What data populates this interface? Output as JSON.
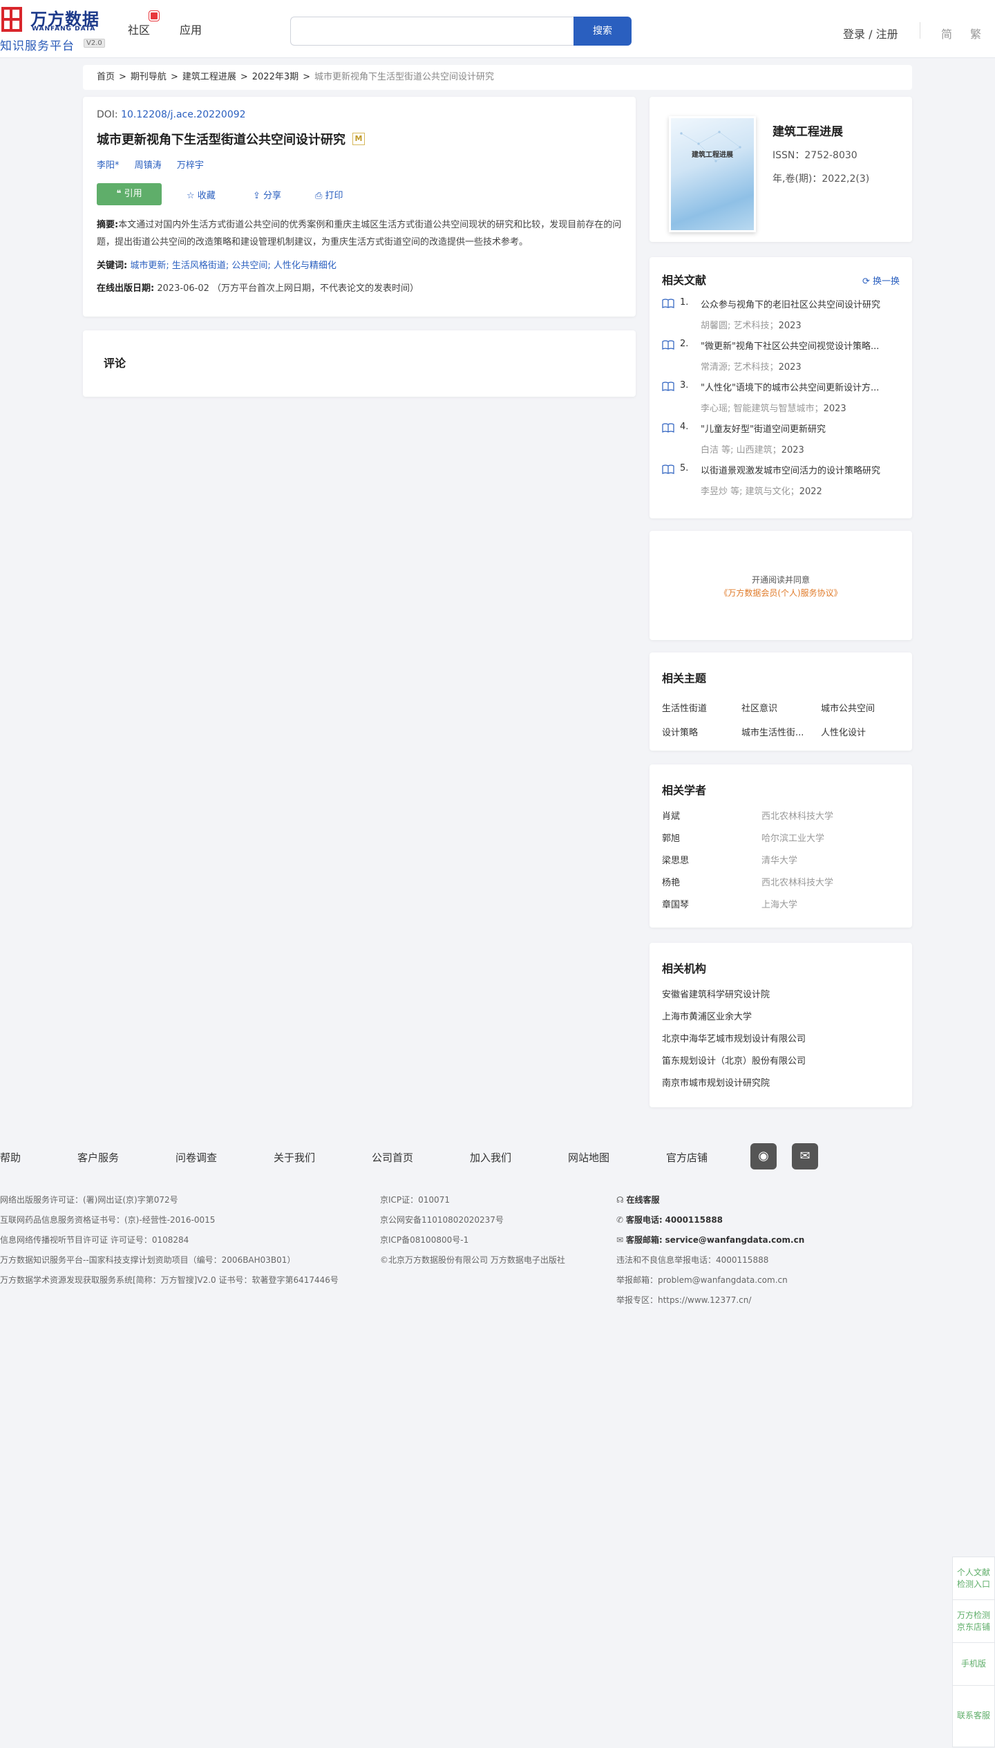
{
  "header": {
    "logo_cn": "万方数据",
    "logo_en": "WANFANG DATA",
    "logo_sub": "知识服务平台",
    "logo_ver": "V2.0",
    "nav": [
      "社区",
      "应用"
    ],
    "search_placeholder": "",
    "search_btn": "搜索",
    "login": "登录 / 注册",
    "lang_simple": "简",
    "lang_trad": "繁"
  },
  "breadcrumb": [
    "首页",
    "期刊导航",
    "建筑工程进展",
    "2022年3期",
    "城市更新视角下生活型街道公共空间设计研究"
  ],
  "article": {
    "doi_label": "DOI: ",
    "doi": "10.12208/j.ace.20220092",
    "title": "城市更新视角下生活型街道公共空间设计研究",
    "badge": "M",
    "authors": [
      "李阳*",
      "周镇涛",
      "万梓宇"
    ],
    "actions": {
      "cite": "引用",
      "collect": "收藏",
      "share": "分享",
      "print": "打印"
    },
    "abstract_label": "摘要:",
    "abstract": "本文通过对国内外生活方式街道公共空间的优秀案例和重庆主城区生活方式街道公共空间现状的研究和比较，发现目前存在的问题，提出街道公共空间的改造策略和建设管理机制建议，为重庆生活方式街道空间的改造提供一些技术参考。",
    "keywords_label": "关键词:",
    "keywords": "城市更新; 生活风格街道; 公共空间; 人性化与精细化",
    "pubdate_label": "在线出版日期:",
    "pubdate": "2023-06-02",
    "pubdate_note": "（万方平台首次上网日期，不代表论文的发表时间）"
  },
  "comment": {
    "title": "评论"
  },
  "journal": {
    "cover_title": "建筑工程进展",
    "name": "建筑工程进展",
    "issn": "ISSN：2752-8030",
    "vol": "年,卷(期)：2022,2(3)"
  },
  "related": {
    "title": "相关文献",
    "refresh": "换一换",
    "items": [
      {
        "num": "1.",
        "title": "公众参与视角下的老旧社区公共空间设计研究",
        "authors": "胡馨圆;",
        "source": "艺术科技",
        "year": "2023"
      },
      {
        "num": "2.",
        "title": "\"微更新\"视角下社区公共空间视觉设计策略...",
        "authors": "常清源;",
        "source": "艺术科技",
        "year": "2023"
      },
      {
        "num": "3.",
        "title": "\"人性化\"语境下的城市公共空间更新设计方...",
        "authors": "李心瑶;",
        "source": "智能建筑与智慧城市",
        "year": "2023"
      },
      {
        "num": "4.",
        "title": "\"儿童友好型\"街道空间更新研究",
        "authors": "白洁 等;",
        "source": "山西建筑",
        "year": "2023"
      },
      {
        "num": "5.",
        "title": "以街道景观激发城市空间活力的设计策略研究",
        "authors": "李昱炒 等;",
        "source": "建筑与文化",
        "year": "2022"
      }
    ]
  },
  "promo": {
    "line1": "开通阅读并同意",
    "line2": "《万方数据会员(个人)服务协议》"
  },
  "topics": {
    "title": "相关主题",
    "items": [
      "生活性街道",
      "社区意识",
      "城市公共空间",
      "设计策略",
      "城市生活性街...",
      "人性化设计"
    ]
  },
  "scholars": {
    "title": "相关学者",
    "items": [
      {
        "name": "肖斌",
        "org": "西北农林科技大学"
      },
      {
        "name": "郭旭",
        "org": "哈尔滨工业大学"
      },
      {
        "name": "梁思思",
        "org": "清华大学"
      },
      {
        "name": "杨艳",
        "org": "西北农林科技大学"
      },
      {
        "name": "章国琴",
        "org": "上海大学"
      }
    ]
  },
  "orgs": {
    "title": "相关机构",
    "items": [
      "安徽省建筑科学研究设计院",
      "上海市黄浦区业余大学",
      "北京中海华艺城市规划设计有限公司",
      "笛东规划设计（北京）股份有限公司",
      "南京市城市规划设计研究院"
    ]
  },
  "footer": {
    "links": [
      "帮助",
      "客户服务",
      "问卷调查",
      "关于我们",
      "公司首页",
      "加入我们",
      "网站地图",
      "官方店铺"
    ],
    "col1": [
      "网络出版服务许可证：(署)网出证(京)字第072号",
      "互联网药品信息服务资格证书号：(京)-经营性-2016-0015",
      "信息网络传播视听节目许可证 许可证号：0108284",
      "万方数据知识服务平台--国家科技支撑计划资助项目（编号：2006BAH03B01）",
      "万方数据学术资源发现获取服务系统[简称：万方智搜]V2.0 证书号：软著登字第6417446号"
    ],
    "col2": [
      "京ICP证：010071",
      "京公网安备11010802020237号",
      "京ICP备08100800号-1",
      "©北京万方数据股份有限公司 万方数据电子出版社"
    ],
    "online_service": "在线客服",
    "phone_label": "客服电话:",
    "phone": "4000115888",
    "email_label": "客服邮箱:",
    "email": "service@wanfangdata.com.cn",
    "report_phone": "违法和不良信息举报电话：4000115888",
    "report_email": "举报邮箱：problem@wanfangdata.com.cn",
    "report_site": "举报专区：https://www.12377.cn/"
  },
  "float": [
    "个人文献检测入口",
    "万方检测京东店铺",
    "手机版",
    "联系客服"
  ]
}
